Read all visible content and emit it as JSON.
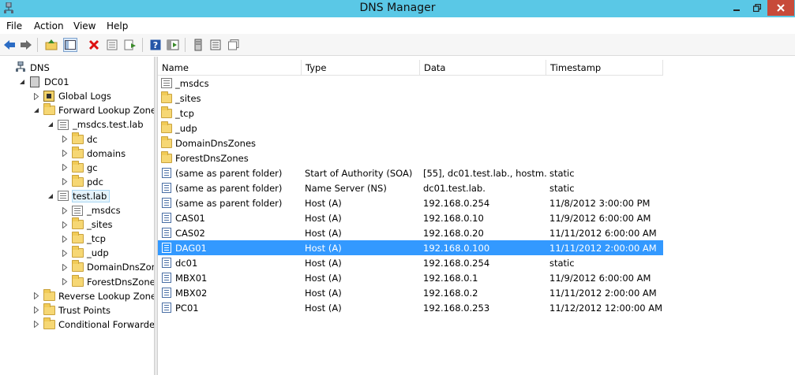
{
  "window": {
    "title": "DNS Manager"
  },
  "menu": {
    "items": [
      "File",
      "Action",
      "View",
      "Help"
    ]
  },
  "toolbar": {
    "buttons": [
      "back-arrow-icon",
      "forward-arrow-icon",
      "up-folder-icon",
      "show-hide-tree-icon",
      "delete-icon",
      "properties-icon",
      "export-icon",
      "help-icon",
      "console-icon",
      "server-icon",
      "list-icon",
      "copy-icon"
    ]
  },
  "tree": {
    "items": [
      {
        "label": "DNS",
        "icon": "dns-icon",
        "indent": 0,
        "expander": "none"
      },
      {
        "label": "DC01",
        "icon": "server-icon",
        "indent": 1,
        "expander": "expanded"
      },
      {
        "label": "Global Logs",
        "icon": "log-icon",
        "indent": 2,
        "expander": "collapsed"
      },
      {
        "label": "Forward Lookup Zones",
        "icon": "folder-icon",
        "indent": 2,
        "expander": "expanded"
      },
      {
        "label": "_msdcs.test.lab",
        "icon": "zone-icon",
        "indent": 3,
        "expander": "expanded"
      },
      {
        "label": "dc",
        "icon": "folder-icon",
        "indent": 4,
        "expander": "collapsed"
      },
      {
        "label": "domains",
        "icon": "folder-icon",
        "indent": 4,
        "expander": "collapsed"
      },
      {
        "label": "gc",
        "icon": "folder-icon",
        "indent": 4,
        "expander": "collapsed"
      },
      {
        "label": "pdc",
        "icon": "folder-icon",
        "indent": 4,
        "expander": "collapsed"
      },
      {
        "label": "test.lab",
        "icon": "zone-icon",
        "indent": 3,
        "expander": "expanded",
        "selected": true
      },
      {
        "label": "_msdcs",
        "icon": "zone-icon",
        "indent": 4,
        "expander": "collapsed"
      },
      {
        "label": "_sites",
        "icon": "folder-icon",
        "indent": 4,
        "expander": "collapsed"
      },
      {
        "label": "_tcp",
        "icon": "folder-icon",
        "indent": 4,
        "expander": "collapsed"
      },
      {
        "label": "_udp",
        "icon": "folder-icon",
        "indent": 4,
        "expander": "collapsed"
      },
      {
        "label": "DomainDnsZones",
        "icon": "folder-icon",
        "indent": 4,
        "expander": "collapsed"
      },
      {
        "label": "ForestDnsZones",
        "icon": "folder-icon",
        "indent": 4,
        "expander": "collapsed"
      },
      {
        "label": "Reverse Lookup Zones",
        "icon": "folder-icon",
        "indent": 2,
        "expander": "collapsed"
      },
      {
        "label": "Trust Points",
        "icon": "folder-icon",
        "indent": 2,
        "expander": "collapsed"
      },
      {
        "label": "Conditional Forwarders",
        "icon": "folder-icon",
        "indent": 2,
        "expander": "collapsed"
      }
    ]
  },
  "list": {
    "columns": [
      "Name",
      "Type",
      "Data",
      "Timestamp"
    ],
    "rows": [
      {
        "name": "_msdcs",
        "type": "",
        "data": "",
        "timestamp": "",
        "icon": "zone-icon"
      },
      {
        "name": "_sites",
        "type": "",
        "data": "",
        "timestamp": "",
        "icon": "folder-icon"
      },
      {
        "name": "_tcp",
        "type": "",
        "data": "",
        "timestamp": "",
        "icon": "folder-icon"
      },
      {
        "name": "_udp",
        "type": "",
        "data": "",
        "timestamp": "",
        "icon": "folder-icon"
      },
      {
        "name": "DomainDnsZones",
        "type": "",
        "data": "",
        "timestamp": "",
        "icon": "folder-icon"
      },
      {
        "name": "ForestDnsZones",
        "type": "",
        "data": "",
        "timestamp": "",
        "icon": "folder-icon"
      },
      {
        "name": "(same as parent folder)",
        "type": "Start of Authority (SOA)",
        "data": "[55], dc01.test.lab., hostm...",
        "timestamp": "static",
        "icon": "record-icon"
      },
      {
        "name": "(same as parent folder)",
        "type": "Name Server (NS)",
        "data": "dc01.test.lab.",
        "timestamp": "static",
        "icon": "record-icon"
      },
      {
        "name": "(same as parent folder)",
        "type": "Host (A)",
        "data": "192.168.0.254",
        "timestamp": "11/8/2012 3:00:00 PM",
        "icon": "record-icon"
      },
      {
        "name": "CAS01",
        "type": "Host (A)",
        "data": "192.168.0.10",
        "timestamp": "11/9/2012 6:00:00 AM",
        "icon": "record-icon"
      },
      {
        "name": "CAS02",
        "type": "Host (A)",
        "data": "192.168.0.20",
        "timestamp": "11/11/2012 6:00:00 AM",
        "icon": "record-icon"
      },
      {
        "name": "DAG01",
        "type": "Host (A)",
        "data": "192.168.0.100",
        "timestamp": "11/11/2012 2:00:00 AM",
        "icon": "record-icon",
        "selected": true
      },
      {
        "name": "dc01",
        "type": "Host (A)",
        "data": "192.168.0.254",
        "timestamp": "static",
        "icon": "record-icon"
      },
      {
        "name": "MBX01",
        "type": "Host (A)",
        "data": "192.168.0.1",
        "timestamp": "11/9/2012 6:00:00 AM",
        "icon": "record-icon"
      },
      {
        "name": "MBX02",
        "type": "Host (A)",
        "data": "192.168.0.2",
        "timestamp": "11/11/2012 2:00:00 AM",
        "icon": "record-icon"
      },
      {
        "name": "PC01",
        "type": "Host (A)",
        "data": "192.168.0.253",
        "timestamp": "11/12/2012 12:00:00 AM",
        "icon": "record-icon"
      }
    ]
  },
  "colors": {
    "titlebar": "#5ac8e6",
    "selection": "#3399ff",
    "close_button": "#c74a3a"
  }
}
